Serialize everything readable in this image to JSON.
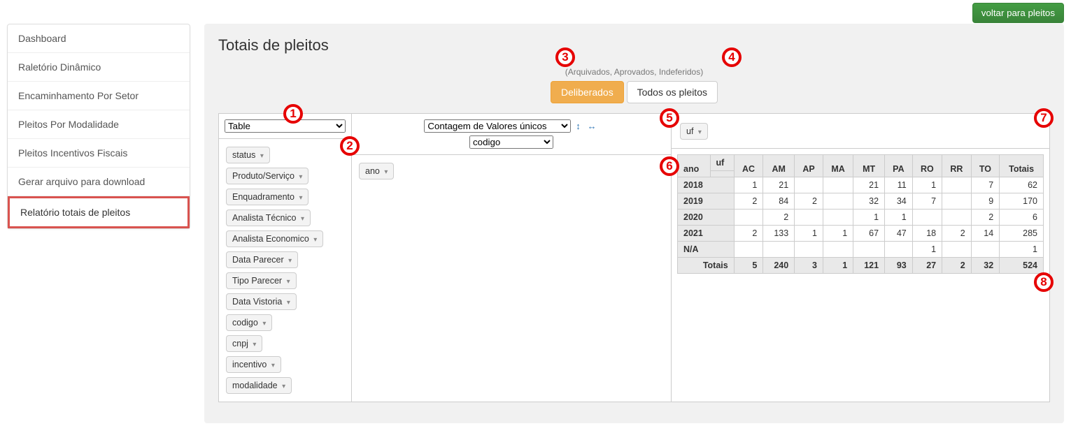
{
  "top_button": "voltar para pleitos",
  "sidebar": {
    "items": [
      {
        "label": "Dashboard",
        "active": false
      },
      {
        "label": "Raletório Dinâmico",
        "active": false
      },
      {
        "label": "Encaminhamento Por Setor",
        "active": false
      },
      {
        "label": "Pleitos Por Modalidade",
        "active": false
      },
      {
        "label": "Pleitos Incentivos Fiscais",
        "active": false
      },
      {
        "label": "Gerar arquivo para download",
        "active": false
      },
      {
        "label": "Relatório totais de pleitos",
        "active": true
      }
    ]
  },
  "page_title": "Totais de pleitos",
  "filter_hint": "(Arquivados, Aprovados, Indeferidos)",
  "buttons": {
    "deliberados": "Deliberados",
    "todos": "Todos os pleitos"
  },
  "renderer_select": "Table",
  "aggregator_select": "Contagem de Valores únicos",
  "attribute_select": "codigo",
  "expand_icons": {
    "vertical": "↕",
    "horizontal": "↔"
  },
  "unused_attrs": [
    "status",
    "Produto/Serviço",
    "Enquadramento",
    "Analista Técnico",
    "Analista Economico",
    "Data Parecer",
    "Tipo Parecer",
    "Data Vistoria",
    "codigo",
    "cnpj",
    "incentivo",
    "modalidade"
  ],
  "row_attr": "ano",
  "col_attr": "uf",
  "chart_data": {
    "type": "table",
    "col_label": "uf",
    "row_label": "ano",
    "columns": [
      "AC",
      "AM",
      "AP",
      "MA",
      "MT",
      "PA",
      "RO",
      "RR",
      "TO"
    ],
    "rows": [
      {
        "label": "2018",
        "values": [
          1,
          21,
          null,
          null,
          21,
          11,
          1,
          null,
          7,
          62
        ]
      },
      {
        "label": "2019",
        "values": [
          2,
          84,
          2,
          null,
          32,
          34,
          7,
          null,
          9,
          170
        ]
      },
      {
        "label": "2020",
        "values": [
          null,
          2,
          null,
          null,
          1,
          1,
          null,
          null,
          2,
          6
        ]
      },
      {
        "label": "2021",
        "values": [
          2,
          133,
          1,
          1,
          67,
          47,
          18,
          2,
          14,
          285
        ]
      },
      {
        "label": "N/A",
        "values": [
          null,
          null,
          null,
          null,
          null,
          null,
          1,
          null,
          null,
          1
        ]
      }
    ],
    "totals_label": "Totais",
    "totals": [
      5,
      240,
      3,
      1,
      121,
      93,
      27,
      2,
      32,
      524
    ]
  },
  "markers": [
    "1",
    "2",
    "3",
    "4",
    "5",
    "6",
    "7",
    "8"
  ]
}
